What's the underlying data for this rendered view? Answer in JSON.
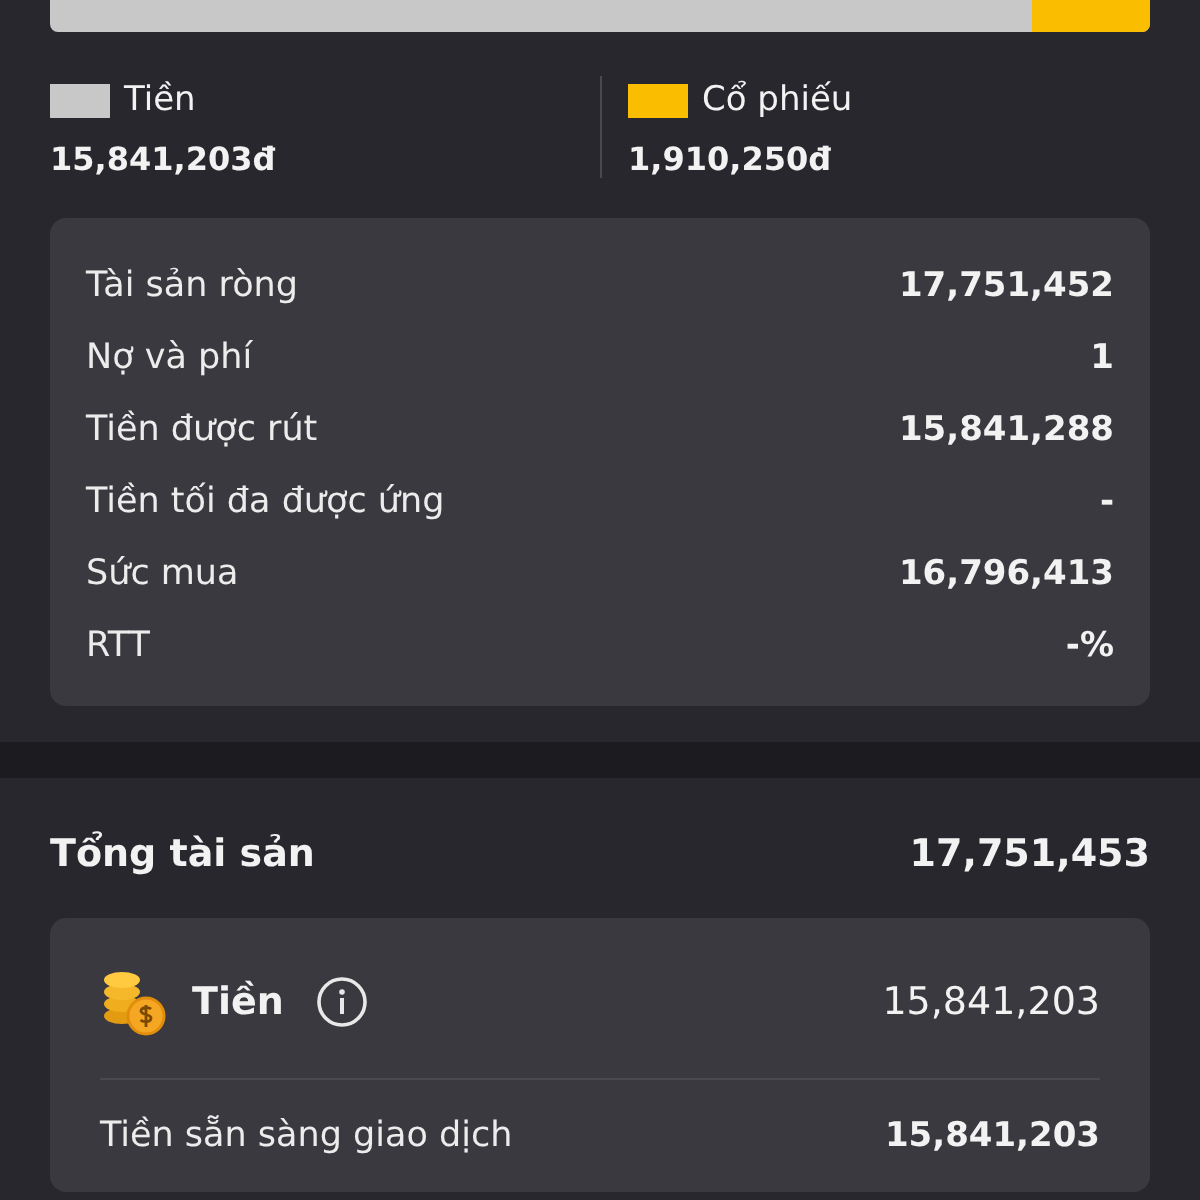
{
  "allocation_bar": {
    "level": 0.108
  },
  "legend": [
    {
      "label": "Tiền",
      "value": "15,841,203đ",
      "color": "#c8c8c8"
    },
    {
      "label": "Cổ phiếu",
      "value": "1,910,250đ",
      "color": "#fbbd00"
    }
  ],
  "summary": [
    {
      "label": "Tài sản ròng",
      "value": "17,751,452"
    },
    {
      "label": "Nợ và phí",
      "value": "1"
    },
    {
      "label": "Tiền được rút",
      "value": "15,841,288"
    },
    {
      "label": "Tiền tối đa được ứng",
      "value": "-"
    },
    {
      "label": "Sức mua",
      "value": "16,796,413"
    },
    {
      "label": "RTT",
      "value": "-%"
    }
  ],
  "total": {
    "label": "Tổng tài sản",
    "value": "17,751,453"
  },
  "cash_card": {
    "title": "Tiền",
    "value": "15,841,203",
    "rows": [
      {
        "label": "Tiền sẵn sàng giao dịch",
        "value": "15,841,203"
      }
    ]
  }
}
